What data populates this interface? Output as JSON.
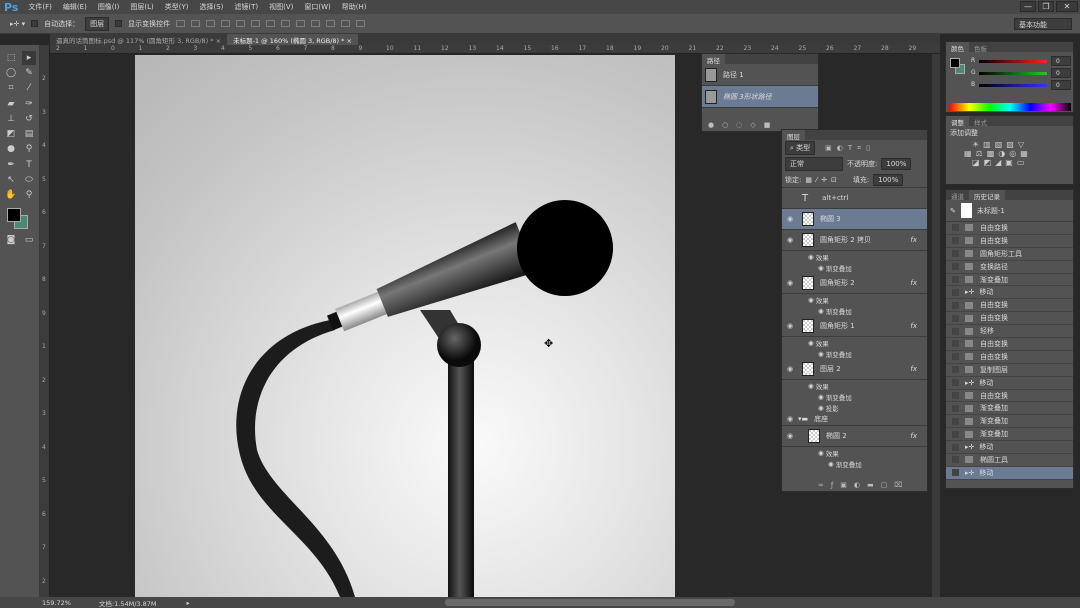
{
  "app": {
    "logo": "Ps",
    "menu": [
      "文件(F)",
      "编辑(E)",
      "图像(I)",
      "图层(L)",
      "类型(Y)",
      "选择(S)",
      "滤镜(T)",
      "视图(V)",
      "窗口(W)",
      "帮助(H)"
    ],
    "window_buttons": [
      "—",
      "❐",
      "✕"
    ]
  },
  "options": {
    "auto_select_label": "自动选择：",
    "auto_select_value": "图层",
    "show_transform_label": "显示变换控件",
    "workspace": "基本功能"
  },
  "tabs": [
    {
      "label": "逼真的话筒图标.psd @ 117% (圆角矩形 3, RGB/8) *",
      "close": "×"
    },
    {
      "label": "未标题-1 @ 160% (椭圆 3, RGB/8) *",
      "close": "×",
      "active": true
    }
  ],
  "ruler_top": [
    "2",
    "1",
    "0",
    "1",
    "2",
    "3",
    "4",
    "5",
    "6",
    "7",
    "8",
    "9",
    "10",
    "11",
    "12",
    "13",
    "14",
    "15",
    "16",
    "17",
    "18",
    "19",
    "20",
    "21",
    "22",
    "23",
    "24",
    "25",
    "26",
    "27",
    "28",
    "29"
  ],
  "ruler_left": [
    "2",
    "3",
    "4",
    "5",
    "6",
    "7",
    "8",
    "9",
    "1",
    "2",
    "3",
    "4",
    "5",
    "6",
    "7",
    "2"
  ],
  "paths_panel": {
    "title": "路径",
    "items": [
      {
        "label": "路径 1"
      },
      {
        "label": "椭圆 3形状路径",
        "selected": true
      }
    ]
  },
  "layers_panel": {
    "title": "图层",
    "filter": "类型",
    "blend": "正常",
    "opacity_label": "不透明度:",
    "opacity": "100%",
    "lock_label": "锁定:",
    "fill_label": "填充:",
    "fill": "100%",
    "layers": [
      {
        "name": "alt+ctrl",
        "type": "text",
        "visible": false
      },
      {
        "name": "椭圆 3",
        "selected": true
      },
      {
        "name": "圆角矩形 2 拷贝",
        "fx": true,
        "effects": [
          "渐变叠加"
        ]
      },
      {
        "name": "圆角矩形 2",
        "fx": true,
        "effects": [
          "渐变叠加"
        ]
      },
      {
        "name": "圆角矩形 1",
        "fx": true,
        "effects": [
          "渐变叠加"
        ]
      },
      {
        "name": "图层 2",
        "fx": true,
        "effects": [
          "渐变叠加",
          "投影"
        ]
      },
      {
        "name": "底座",
        "type": "group"
      },
      {
        "name": "椭圆 2",
        "fx": true,
        "indent": true,
        "effects": [
          "渐变叠加"
        ]
      }
    ],
    "effects_label": "效果",
    "fx_label": "fx"
  },
  "color_panel": {
    "tabs": [
      "颜色",
      "色板"
    ],
    "r": "0",
    "g": "0",
    "b": "0",
    "labels": [
      "R",
      "G",
      "B"
    ],
    "fg": "#000000",
    "bg": "#4a8a73"
  },
  "adjust_panel": {
    "tabs": [
      "调整",
      "样式"
    ],
    "title": "添加调整"
  },
  "history_panel": {
    "tabs": [
      "通道",
      "历史记录"
    ],
    "snapshot": "未标题-1",
    "items": [
      {
        "label": "自由变换"
      },
      {
        "label": "自由变换"
      },
      {
        "label": "圆角矩形工具"
      },
      {
        "label": "变换路径"
      },
      {
        "label": "渐变叠加"
      },
      {
        "label": "移动",
        "move": true
      },
      {
        "label": "自由变换"
      },
      {
        "label": "自由变换"
      },
      {
        "label": "轻移"
      },
      {
        "label": "自由变换"
      },
      {
        "label": "自由变换"
      },
      {
        "label": "复制图层"
      },
      {
        "label": "移动",
        "move": true
      },
      {
        "label": "自由变换"
      },
      {
        "label": "渐变叠加"
      },
      {
        "label": "渐变叠加"
      },
      {
        "label": "渐变叠加"
      },
      {
        "label": "移动",
        "move": true
      },
      {
        "label": "椭圆工具"
      },
      {
        "label": "移动",
        "move": true,
        "selected": true
      }
    ]
  },
  "status": {
    "zoom": "159.72%",
    "doc": "文档:1.54M/3.87M"
  }
}
